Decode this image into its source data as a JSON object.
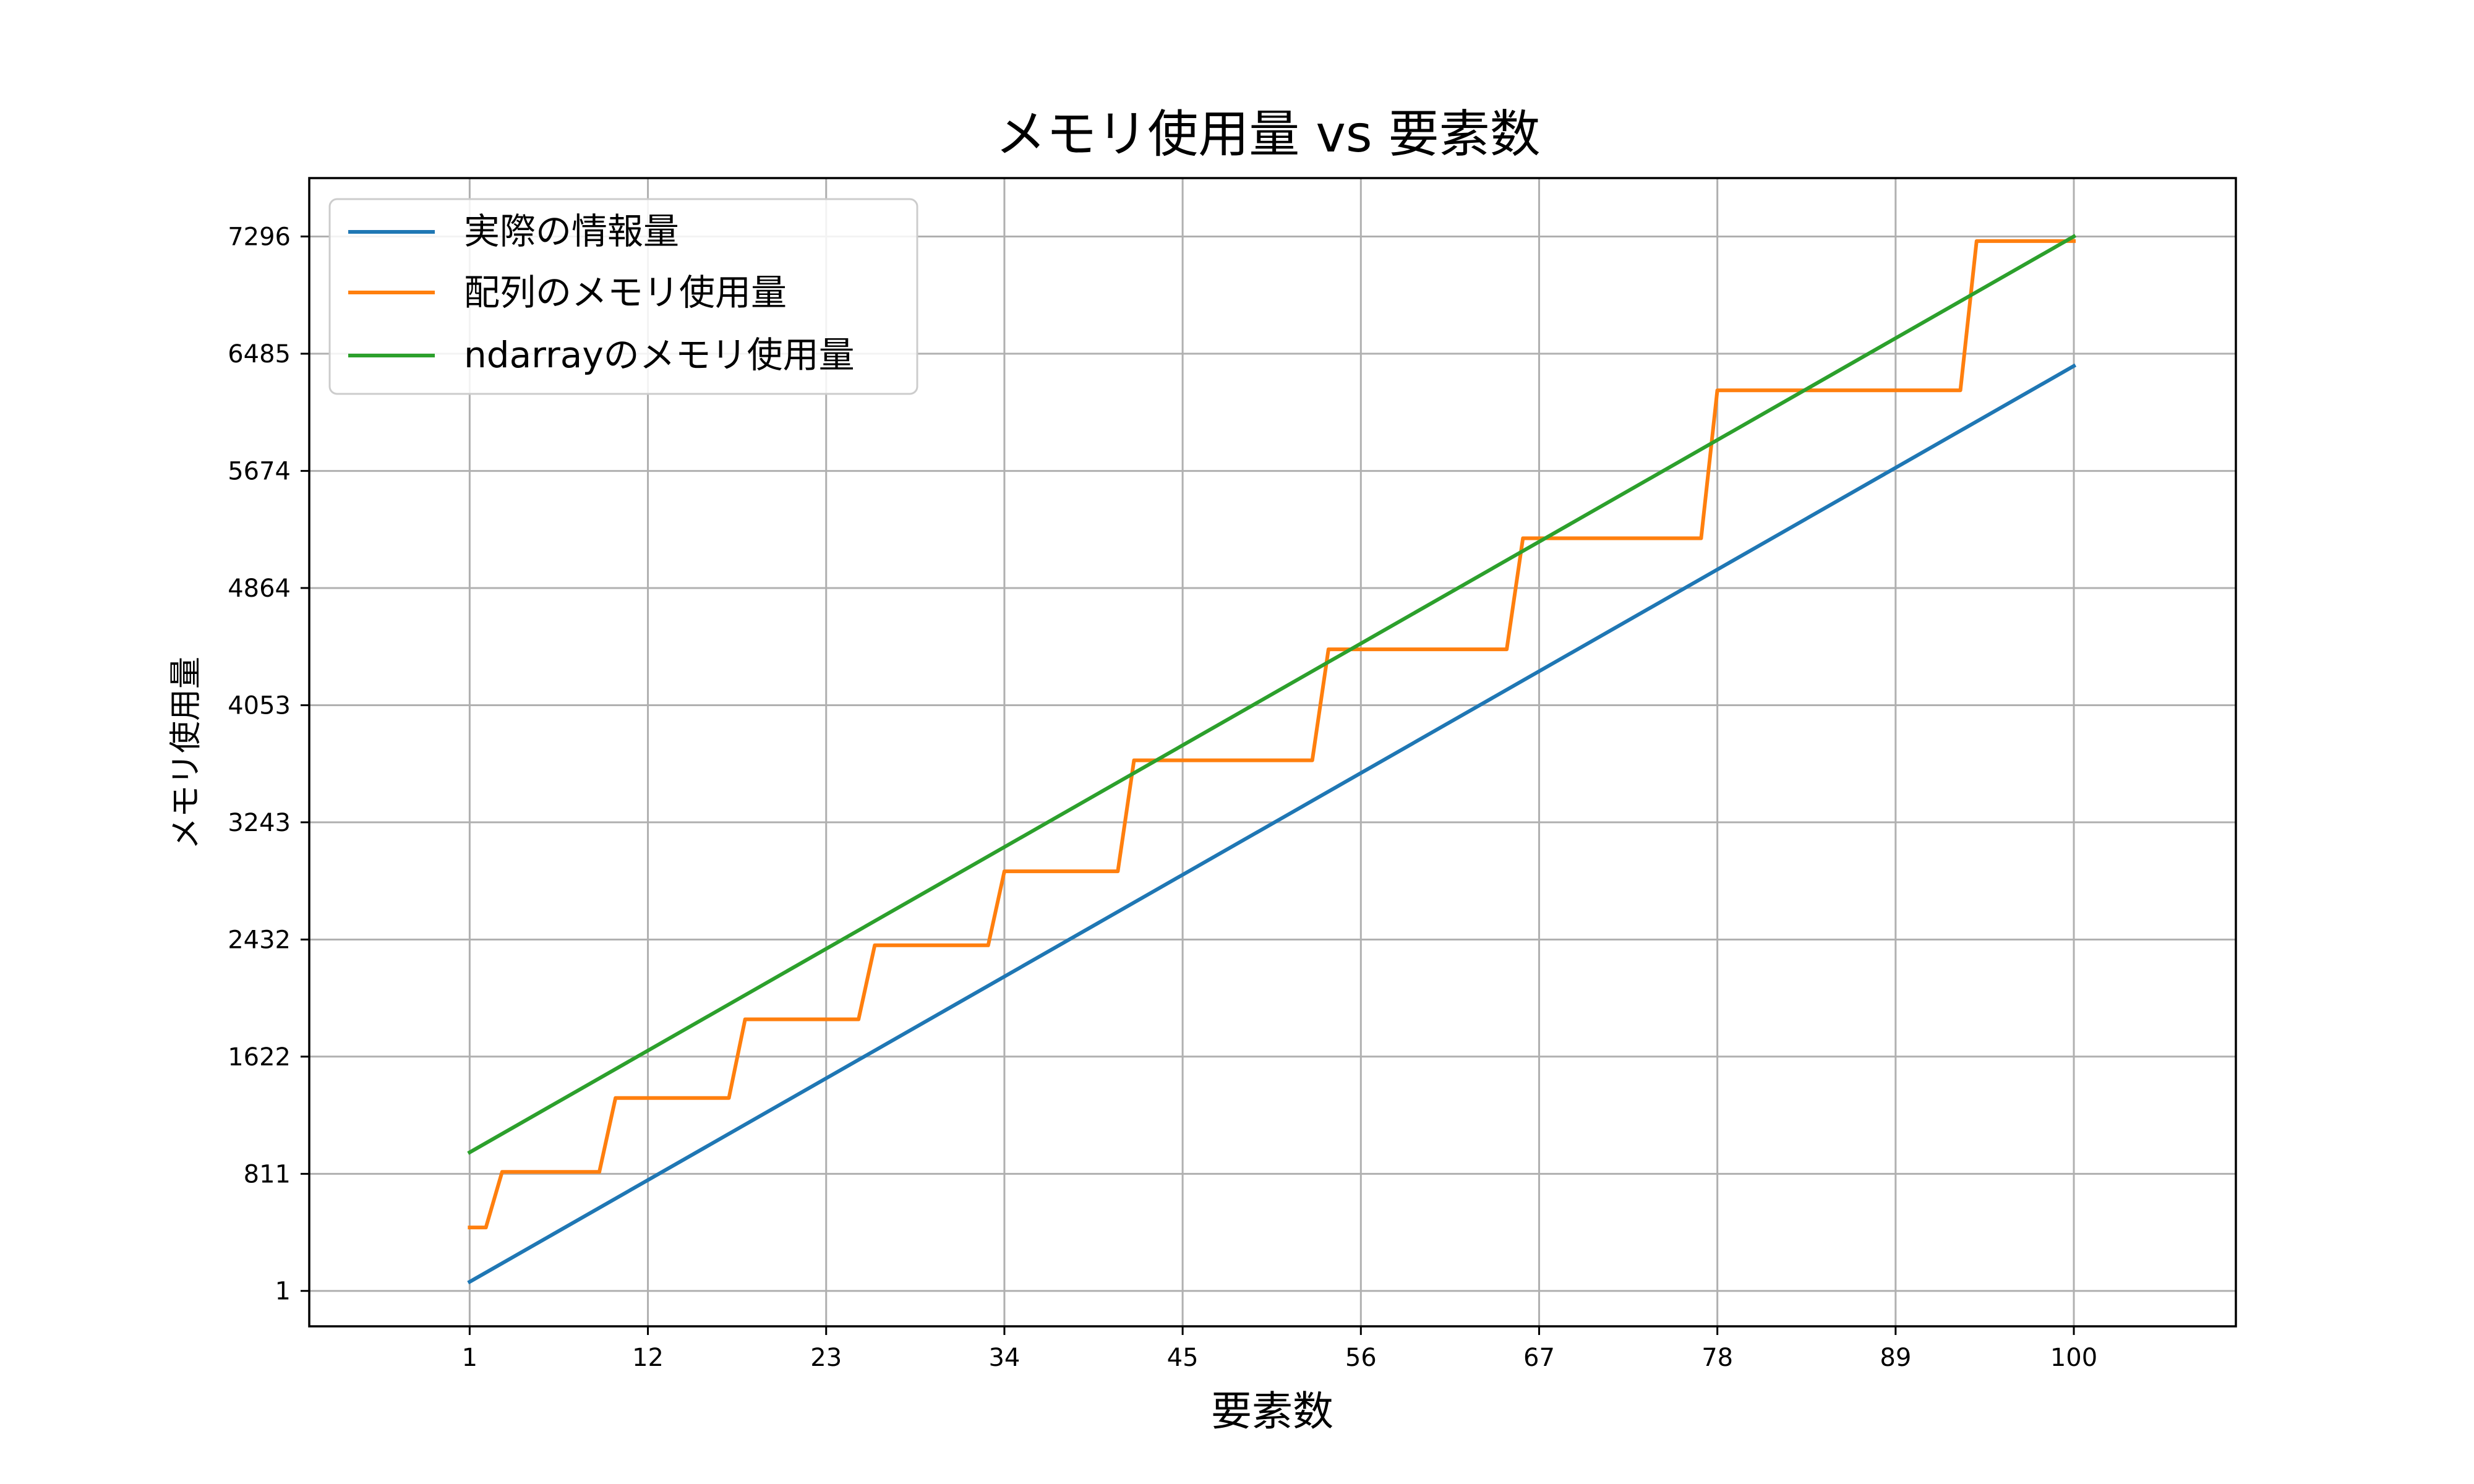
{
  "chart_data": {
    "type": "line",
    "title": "メモリ使用量 vs 要素数",
    "xlabel": "要素数",
    "ylabel": "メモリ使用量",
    "xlim": [
      -8.9,
      110
    ],
    "ylim": [
      -244,
      7700
    ],
    "xticks": [
      1,
      12,
      23,
      34,
      45,
      56,
      67,
      78,
      89,
      100
    ],
    "xtick_labels": [
      "1",
      "12",
      "23",
      "34",
      "45",
      "56",
      "67",
      "78",
      "89",
      "100"
    ],
    "yticks": [
      1,
      811,
      1622,
      2432,
      3243,
      4053,
      4864,
      5674,
      6485,
      7296
    ],
    "ytick_labels": [
      "1",
      "811",
      "1622",
      "2432",
      "3243",
      "4053",
      "4864",
      "5674",
      "6485",
      "7296"
    ],
    "grid": true,
    "legend_position": "top-left",
    "series": [
      {
        "name": "実際の情報量",
        "color": "#1f77b4",
        "style": "linear",
        "x": [
          1,
          100
        ],
        "y": [
          64,
          6400
        ]
      },
      {
        "name": "配列のメモリ使用量",
        "color": "#ff7f0e",
        "style": "step",
        "x": [
          1,
          2,
          3,
          9,
          10,
          17,
          18,
          25,
          26,
          33,
          34,
          41,
          42,
          53,
          54,
          65,
          66,
          77,
          78,
          93,
          94,
          100
        ],
        "y": [
          440,
          440,
          824,
          824,
          1336,
          1336,
          1880,
          1880,
          2392,
          2392,
          2904,
          2904,
          3672,
          3672,
          4440,
          4440,
          5208,
          5208,
          6232,
          6232,
          7264,
          7264
        ]
      },
      {
        "name": "ndarrayのメモリ使用量",
        "color": "#2ca02c",
        "style": "linear",
        "x": [
          1,
          100
        ],
        "y": [
          960,
          7296
        ]
      }
    ]
  }
}
